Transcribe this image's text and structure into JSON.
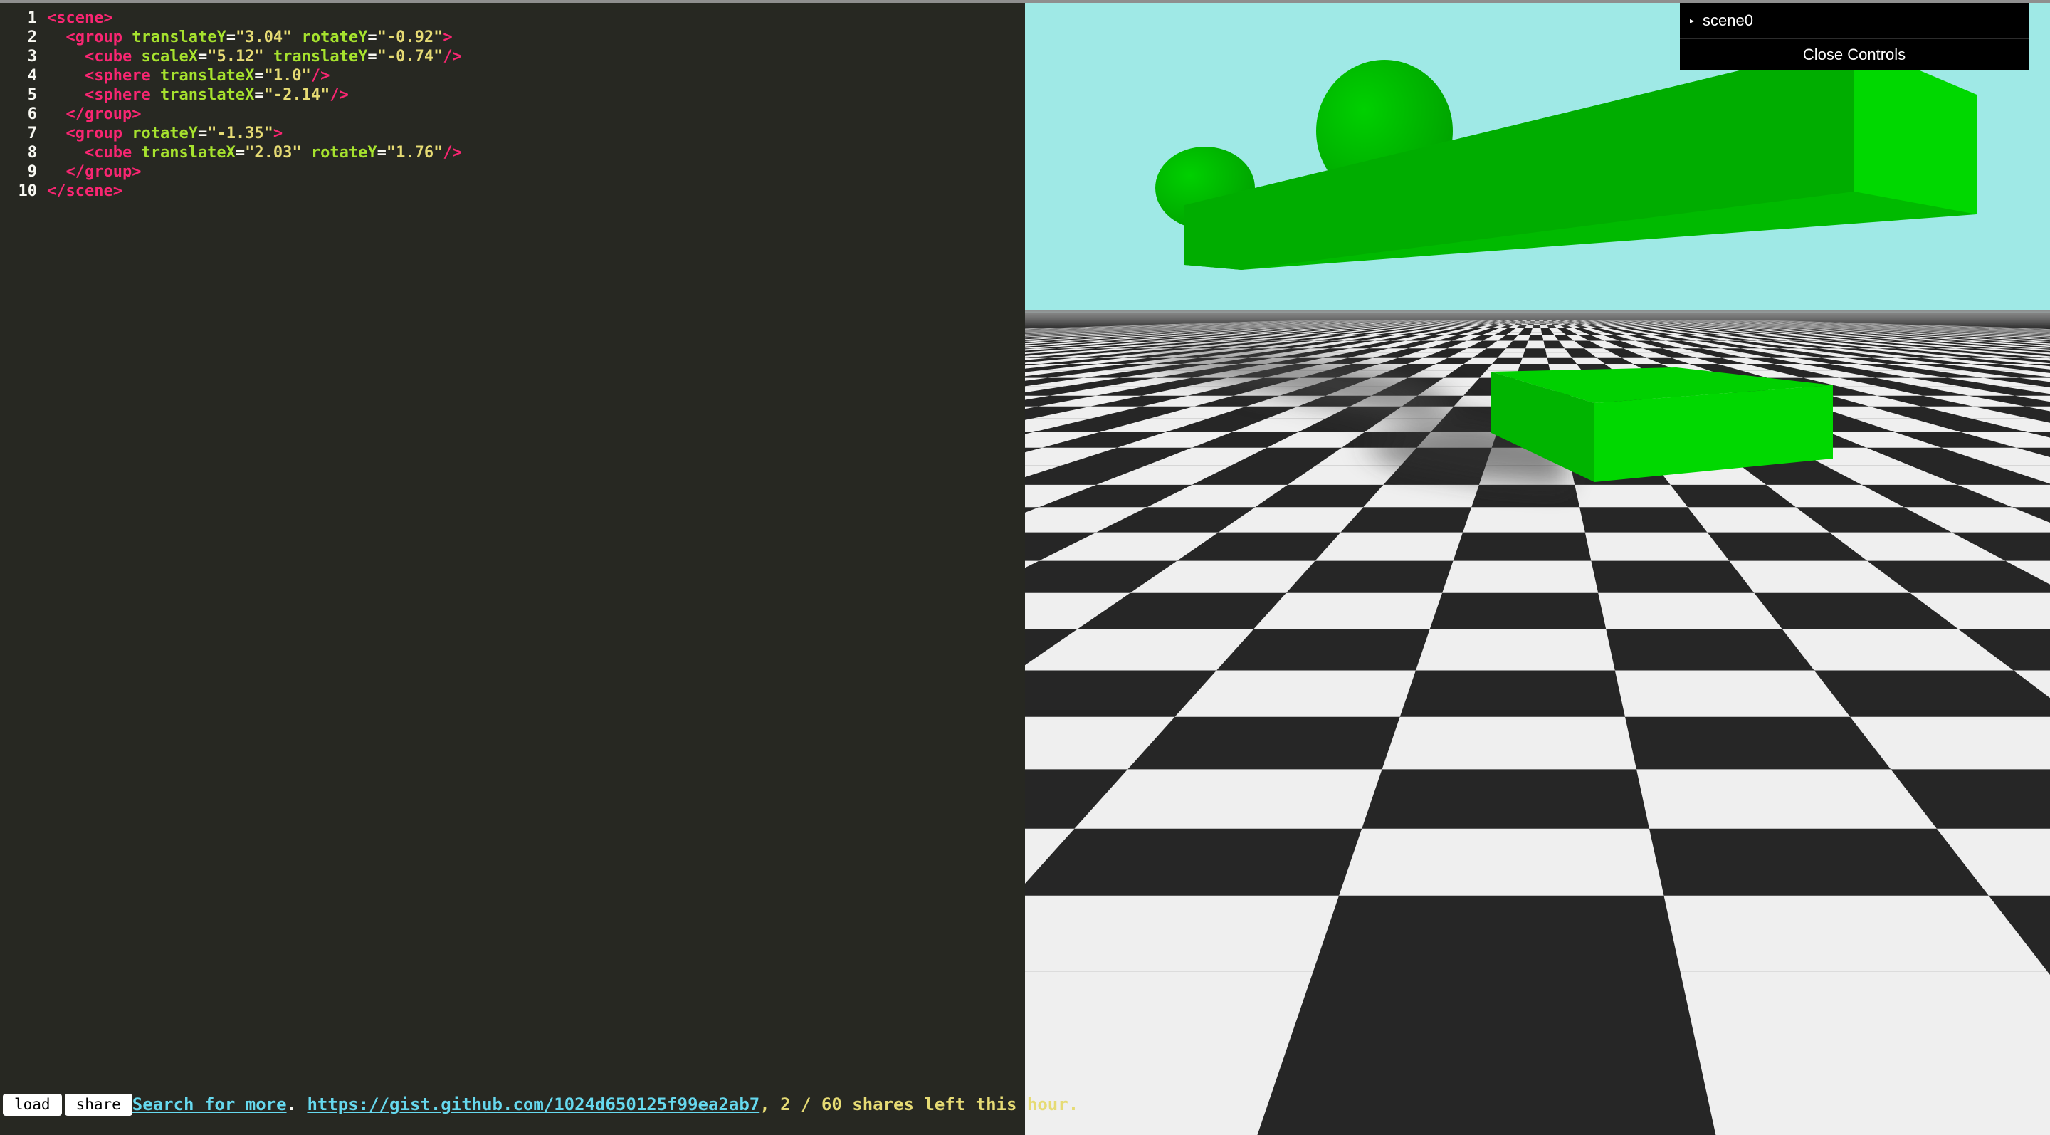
{
  "editor": {
    "lines": [
      {
        "num": "1",
        "tokens": [
          [
            "tag",
            "<scene>"
          ]
        ]
      },
      {
        "num": "2",
        "tokens": [
          [
            "sp",
            "  "
          ],
          [
            "tag",
            "<group"
          ],
          [
            "sp",
            " "
          ],
          [
            "attr",
            "translateY"
          ],
          [
            "eq",
            "="
          ],
          [
            "str",
            "\"3.04\""
          ],
          [
            "sp",
            " "
          ],
          [
            "attr",
            "rotateY"
          ],
          [
            "eq",
            "="
          ],
          [
            "str",
            "\"-0.92\""
          ],
          [
            "tag",
            ">"
          ]
        ]
      },
      {
        "num": "3",
        "tokens": [
          [
            "sp",
            "    "
          ],
          [
            "tag",
            "<cube"
          ],
          [
            "sp",
            " "
          ],
          [
            "attr",
            "scaleX"
          ],
          [
            "eq",
            "="
          ],
          [
            "str",
            "\"5.12\""
          ],
          [
            "sp",
            " "
          ],
          [
            "attr",
            "translateY"
          ],
          [
            "eq",
            "="
          ],
          [
            "str",
            "\"-0.74\""
          ],
          [
            "tag",
            "/>"
          ]
        ]
      },
      {
        "num": "4",
        "tokens": [
          [
            "sp",
            "    "
          ],
          [
            "tag",
            "<sphere"
          ],
          [
            "sp",
            " "
          ],
          [
            "attr",
            "translateX"
          ],
          [
            "eq",
            "="
          ],
          [
            "str",
            "\"1.0\""
          ],
          [
            "tag",
            "/>"
          ]
        ]
      },
      {
        "num": "5",
        "tokens": [
          [
            "sp",
            "    "
          ],
          [
            "tag",
            "<sphere"
          ],
          [
            "sp",
            " "
          ],
          [
            "attr",
            "translateX"
          ],
          [
            "eq",
            "="
          ],
          [
            "str",
            "\"-2.14\""
          ],
          [
            "tag",
            "/>"
          ]
        ]
      },
      {
        "num": "6",
        "tokens": [
          [
            "sp",
            "  "
          ],
          [
            "tag",
            "</group>"
          ]
        ]
      },
      {
        "num": "7",
        "tokens": [
          [
            "sp",
            "  "
          ],
          [
            "tag",
            "<group"
          ],
          [
            "sp",
            " "
          ],
          [
            "attr",
            "rotateY"
          ],
          [
            "eq",
            "="
          ],
          [
            "str",
            "\"-1.35\""
          ],
          [
            "tag",
            ">"
          ]
        ]
      },
      {
        "num": "8",
        "tokens": [
          [
            "sp",
            "    "
          ],
          [
            "tag",
            "<cube"
          ],
          [
            "sp",
            " "
          ],
          [
            "attr",
            "translateX"
          ],
          [
            "eq",
            "="
          ],
          [
            "str",
            "\"2.03\""
          ],
          [
            "sp",
            " "
          ],
          [
            "attr",
            "rotateY"
          ],
          [
            "eq",
            "="
          ],
          [
            "str",
            "\"1.76\""
          ],
          [
            "tag",
            "/>"
          ]
        ]
      },
      {
        "num": "9",
        "tokens": [
          [
            "sp",
            "  "
          ],
          [
            "tag",
            "</group>"
          ]
        ]
      },
      {
        "num": "10",
        "tokens": [
          [
            "tag",
            "</scene>"
          ]
        ]
      }
    ]
  },
  "gui": {
    "folder_label": "scene0",
    "close_label": "Close Controls"
  },
  "bottombar": {
    "load_label": "load",
    "share_label": "share",
    "search_link": "Search for more",
    "period": ". ",
    "gist_link": "https://gist.github.com/1024d650125f99ea2ab7",
    "shares_text": ", 2 / 60 shares left this hour."
  },
  "colors": {
    "editor_bg": "#272822",
    "sky": "#9fe9e6",
    "object_green": "#00d400",
    "tile_dark": "#262626",
    "tile_light": "#efefef"
  },
  "icons": {
    "folder_arrow": "triangle-right-icon"
  }
}
